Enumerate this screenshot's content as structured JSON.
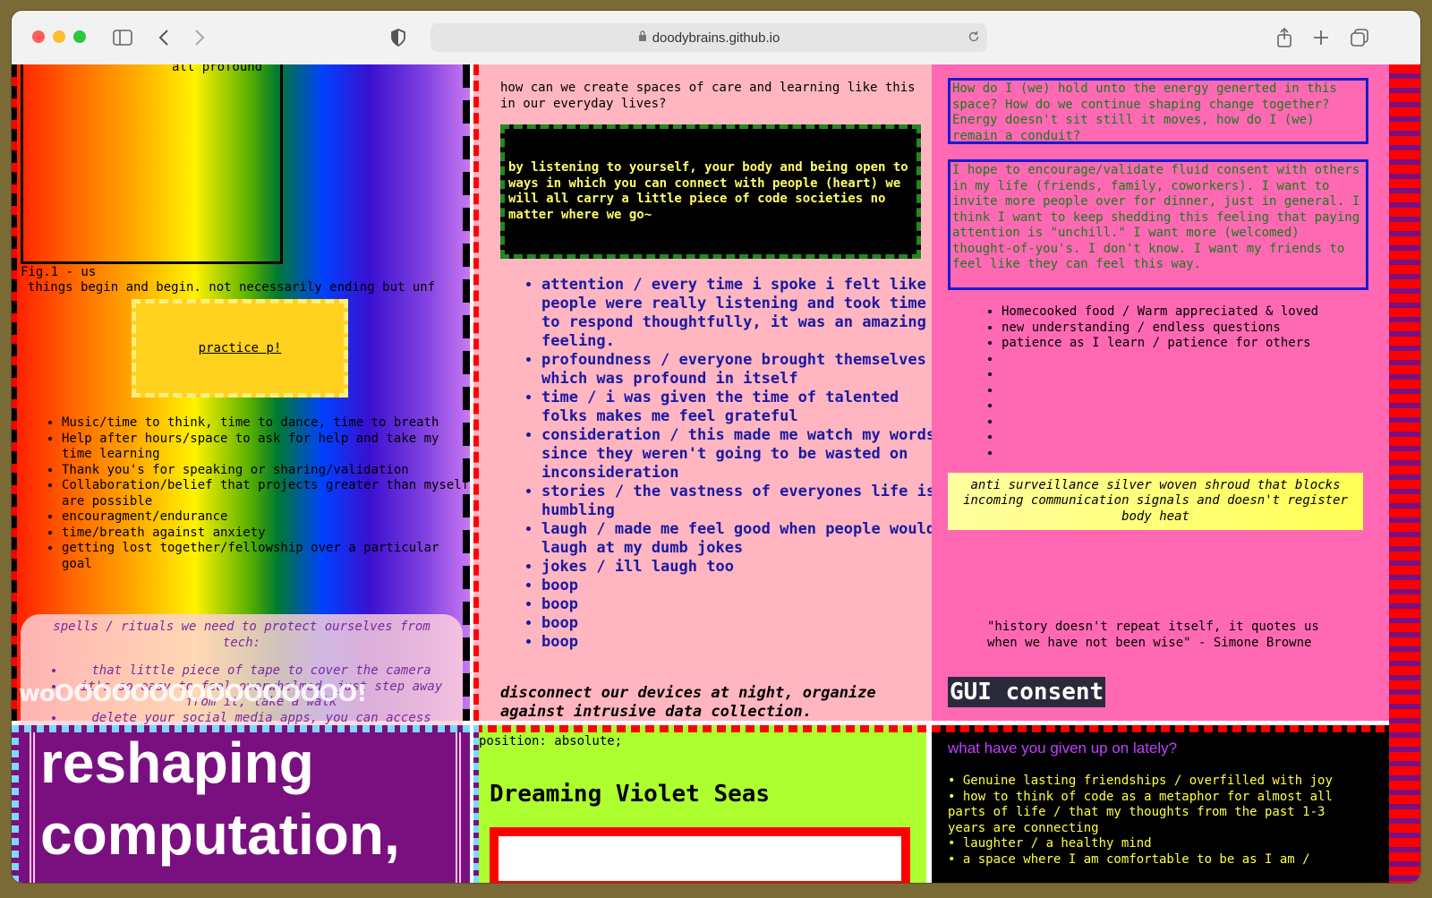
{
  "browser": {
    "url": "doodybrains.github.io"
  },
  "col1": {
    "fig_top_text": "all profound",
    "fig_caption": "Fig.1 - us",
    "lead_text": "things begin and begin. not necessarily ending but unf",
    "practice_link": "practice p!",
    "bullets": [
      "Music/time to think, time to dance, time to breath",
      "Help after hours/space to ask for help and take my time learning",
      "Thank you's for speaking or sharing/validation",
      "Collaboration/belief that projects greater than myself are possible",
      "encouragment/endurance",
      "time/breath against anxiety",
      "getting lost together/fellowship over a particular goal"
    ],
    "spells_heading": "spells / rituals we need to protect ourselves from tech:",
    "spells_items": [
      "that little piece of tape to cover the camera",
      "it's so easy to feel overwhelmed, just step away from it, take a walk",
      "delete your social media apps, you can access"
    ],
    "overlay_text": "woOOOOOOOOOOOOOOOO!",
    "side_char": "s"
  },
  "col2": {
    "question": "how can we create spaces of care and learning like this in our everyday lives?",
    "answer_box": "by listening to yourself, your body and being open to ways in which you can connect with people (heart) we will all carry a little piece of code societies no matter where we go~",
    "bullets": [
      "attention / every time i spoke i felt like people were really listening and took time to respond thoughtfully, it was an amazing feeling.",
      "profoundness / everyone brought themselves which was profound in itself",
      "time / i was given the time of talented folks makes me feel grateful",
      "consideration / this made me watch my words since they weren't going to be wasted on inconsideration",
      "stories / the vastness of everyones life is humbling",
      "laugh / made me feel good when people would laugh at my dumb jokes",
      "jokes / ill laugh too",
      "boop",
      "boop",
      "boop",
      "boop"
    ],
    "closing": "disconnect our devices at night, organize against intrusive data collection."
  },
  "col3": {
    "box1": "How do I (we) hold unto the energy generted in this space? How do we continue shaping change together? Energy doesn't sit still it moves, how do I (we) remain a conduit?",
    "box2": "I hope to encourage/validate fluid consent with others in my life (friends, family, coworkers). I want to invite more people over for dinner, just in general. I think I want to keep shedding this feeling that paying attention is \"unchill.\" I want more (welcomed) thought-of-you's. I don't know. I want my friends to feel like they can feel this way.",
    "bullets": [
      "Homecooked food / Warm appreciated & loved",
      "new understanding / endless questions",
      "patience as I learn / patience for others",
      "",
      "",
      "",
      "",
      "",
      "",
      ""
    ],
    "shroud": "anti surveillance silver woven shroud that blocks incoming communication signals and doesn't register body heat",
    "quote": "\"history doesn't repeat itself, it quotes us when we have not been wise\" - Simone Browne",
    "gui_consent": "GUI consent"
  },
  "bottom": {
    "big_text_1": "reshaping",
    "big_text_2": "computation,",
    "position_label": "position: absolute;",
    "dreaming": "Dreaming Violet Seas",
    "given_up_question": "what have you given up on lately?",
    "given_up_items": [
      "Genuine lasting friendships / overfilled with joy",
      "how to think of code as a metaphor for almost all parts of life / that my thoughts from the past 1-3 years are connecting",
      "laughter / a healthy mind",
      "a space where I am comfortable to be as I am /"
    ]
  }
}
